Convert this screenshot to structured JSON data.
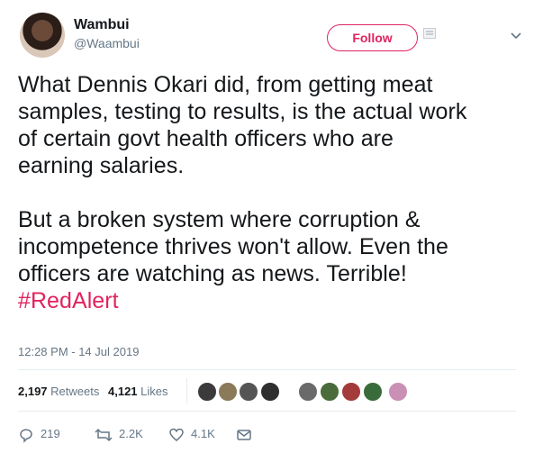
{
  "author": {
    "name": "Wambui",
    "handle": "@Waambui"
  },
  "follow_button": {
    "label": "Follow"
  },
  "tweet": {
    "lines_p1": [
      "What Dennis Okari did, from getting meat",
      "samples, testing to results, is the actual work",
      "of certain govt health officers who are",
      "earning salaries."
    ],
    "lines_p2": [
      "But a broken system where corruption &",
      "incompetence thrives won't allow. Even the",
      "officers are watching as news. Terrible!"
    ],
    "hashtag": "#RedAlert",
    "timestamp": "12:28 PM - 14 Jul 2019"
  },
  "stats": {
    "retweets_count": "2,197",
    "retweets_label": "Retweets",
    "likes_count": "4,121",
    "likes_label": "Likes"
  },
  "liker_colors": [
    "#3b3b3b",
    "#8a7a5a",
    "#555555",
    "#2f2f2f",
    "#6a6a6a",
    "#4a6b3a",
    "#a33b3b",
    "#3a6b3a",
    "#c98fb5"
  ],
  "actions": {
    "replies": "219",
    "retweets": "2.2K",
    "likes": "4.1K"
  },
  "icons": {
    "reply": "reply-icon",
    "retweet": "retweet-icon",
    "like": "heart-icon",
    "dm": "envelope-icon",
    "caret": "chevron-down-icon"
  },
  "colors": {
    "accent": "#e0245e",
    "secondary_text": "#657786",
    "primary_text": "#14171a"
  }
}
